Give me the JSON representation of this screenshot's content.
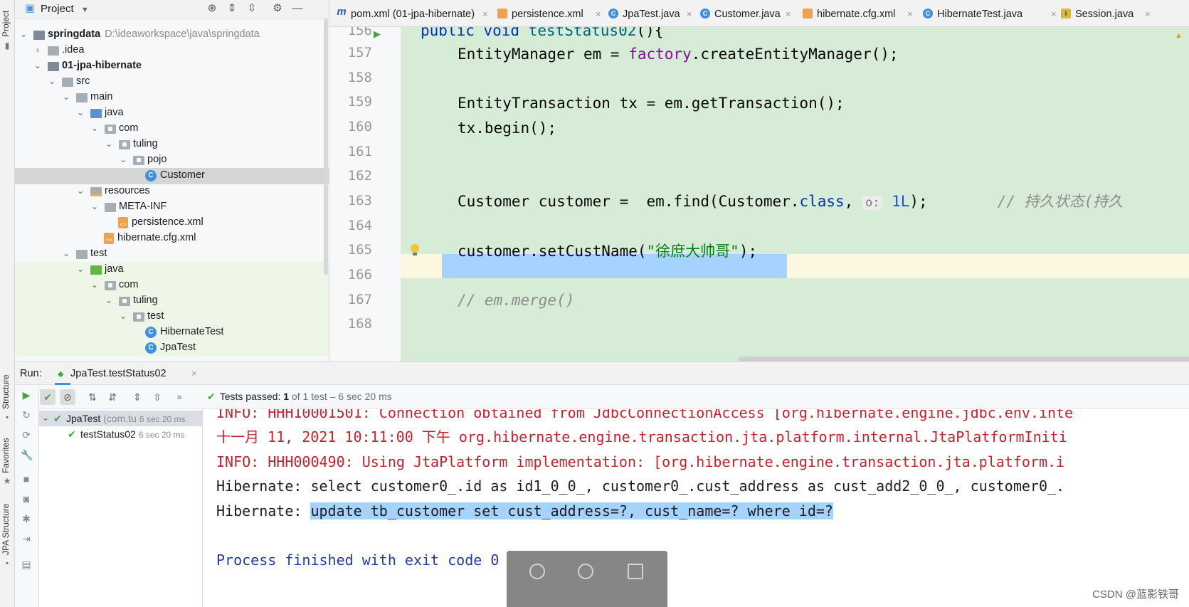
{
  "left_strip": {
    "project": "Project",
    "structure": "Structure",
    "favorites": "Favorites",
    "jpa_structure": "JPA Structure"
  },
  "project_panel": {
    "title": "Project",
    "tree": [
      {
        "label": "springdata",
        "path": "D:\\ideaworkspace\\java\\springdata",
        "bold": true
      },
      {
        "label": ".idea"
      },
      {
        "label": "01-jpa-hibernate",
        "bold": true
      },
      {
        "label": "src"
      },
      {
        "label": "main"
      },
      {
        "label": "java"
      },
      {
        "label": "com"
      },
      {
        "label": "tuling"
      },
      {
        "label": "pojo"
      },
      {
        "label": "Customer"
      },
      {
        "label": "resources"
      },
      {
        "label": "META-INF"
      },
      {
        "label": "persistence.xml"
      },
      {
        "label": "hibernate.cfg.xml"
      },
      {
        "label": "test"
      },
      {
        "label": "java"
      },
      {
        "label": "com"
      },
      {
        "label": "tuling"
      },
      {
        "label": "test"
      },
      {
        "label": "HibernateTest"
      },
      {
        "label": "JpaTest"
      }
    ]
  },
  "tabs": [
    {
      "label": "pom.xml (01-jpa-hibernate)",
      "icon": "m"
    },
    {
      "label": "persistence.xml",
      "icon": "xml-icon"
    },
    {
      "label": "JpaTest.java",
      "icon": "class-icon"
    },
    {
      "label": "Customer.java",
      "icon": "class-icon"
    },
    {
      "label": "hibernate.cfg.xml",
      "icon": "xml-icon"
    },
    {
      "label": "HibernateTest.java",
      "icon": "class-icon"
    },
    {
      "label": "Session.java",
      "icon": "interface-icon"
    }
  ],
  "editor": {
    "line_numbers": [
      "156",
      "157",
      "158",
      "159",
      "160",
      "161",
      "162",
      "163",
      "164",
      "165",
      "166",
      "167",
      "168"
    ],
    "l156": {
      "a": "public void ",
      "b": "testStatus02",
      "c": "(){"
    },
    "l157": {
      "a": "EntityManager em = ",
      "b": "factory",
      "c": ".createEntityManager();"
    },
    "l159": "EntityTransaction tx = em.getTransaction();",
    "l160": "tx.begin();",
    "l163": {
      "a": "Customer customer =  em.find(Customer.",
      "b": "class",
      "c": ", ",
      "hint": "o:",
      "d": "1L",
      "e": ");",
      "comment": "// 持久状态(持久"
    },
    "l165": {
      "a": "customer.setCustName(",
      "b": "\"徐庶大帅哥\"",
      "c": ");"
    },
    "l167": "// em.merge()"
  },
  "run": {
    "label": "Run:",
    "tab": "JpaTest.testStatus02",
    "status": {
      "prefix": "Tests passed: ",
      "passed": "1",
      "suffix": " of 1 test – 6 sec 20 ms"
    },
    "tests": [
      {
        "name": "JpaTest",
        "pkg": "(com.tu",
        "time": "6 sec 20 ms"
      },
      {
        "name": "testStatus02",
        "time": "6 sec 20 ms"
      }
    ],
    "console": [
      "INFO: HHH10001501: Connection obtained from JdbcConnectionAccess [org.hibernate.engine.jdbc.env.inte",
      "十一月 11, 2021 10:11:00 下午 org.hibernate.engine.transaction.jta.platform.internal.JtaPlatformIniti",
      "INFO: HHH000490: Using JtaPlatform implementation: [org.hibernate.engine.transaction.jta.platform.i",
      "Hibernate: select customer0_.id as id1_0_0_, customer0_.cust_address as cust_add2_0_0_, customer0_.",
      {
        "prefix": "Hibernate: ",
        "selected": "update tb_customer set cust_address=?, cust_name=? where id=?"
      },
      "",
      "Process finished with exit code 0"
    ]
  },
  "watermark": "CSDN @蓝影铁哥",
  "colors": {
    "accent": "#3d8fe0",
    "editor_bg": "#d7ecd7",
    "selection": "#a6d2ff",
    "pass": "#41a643",
    "console_red": "#c7222d"
  }
}
